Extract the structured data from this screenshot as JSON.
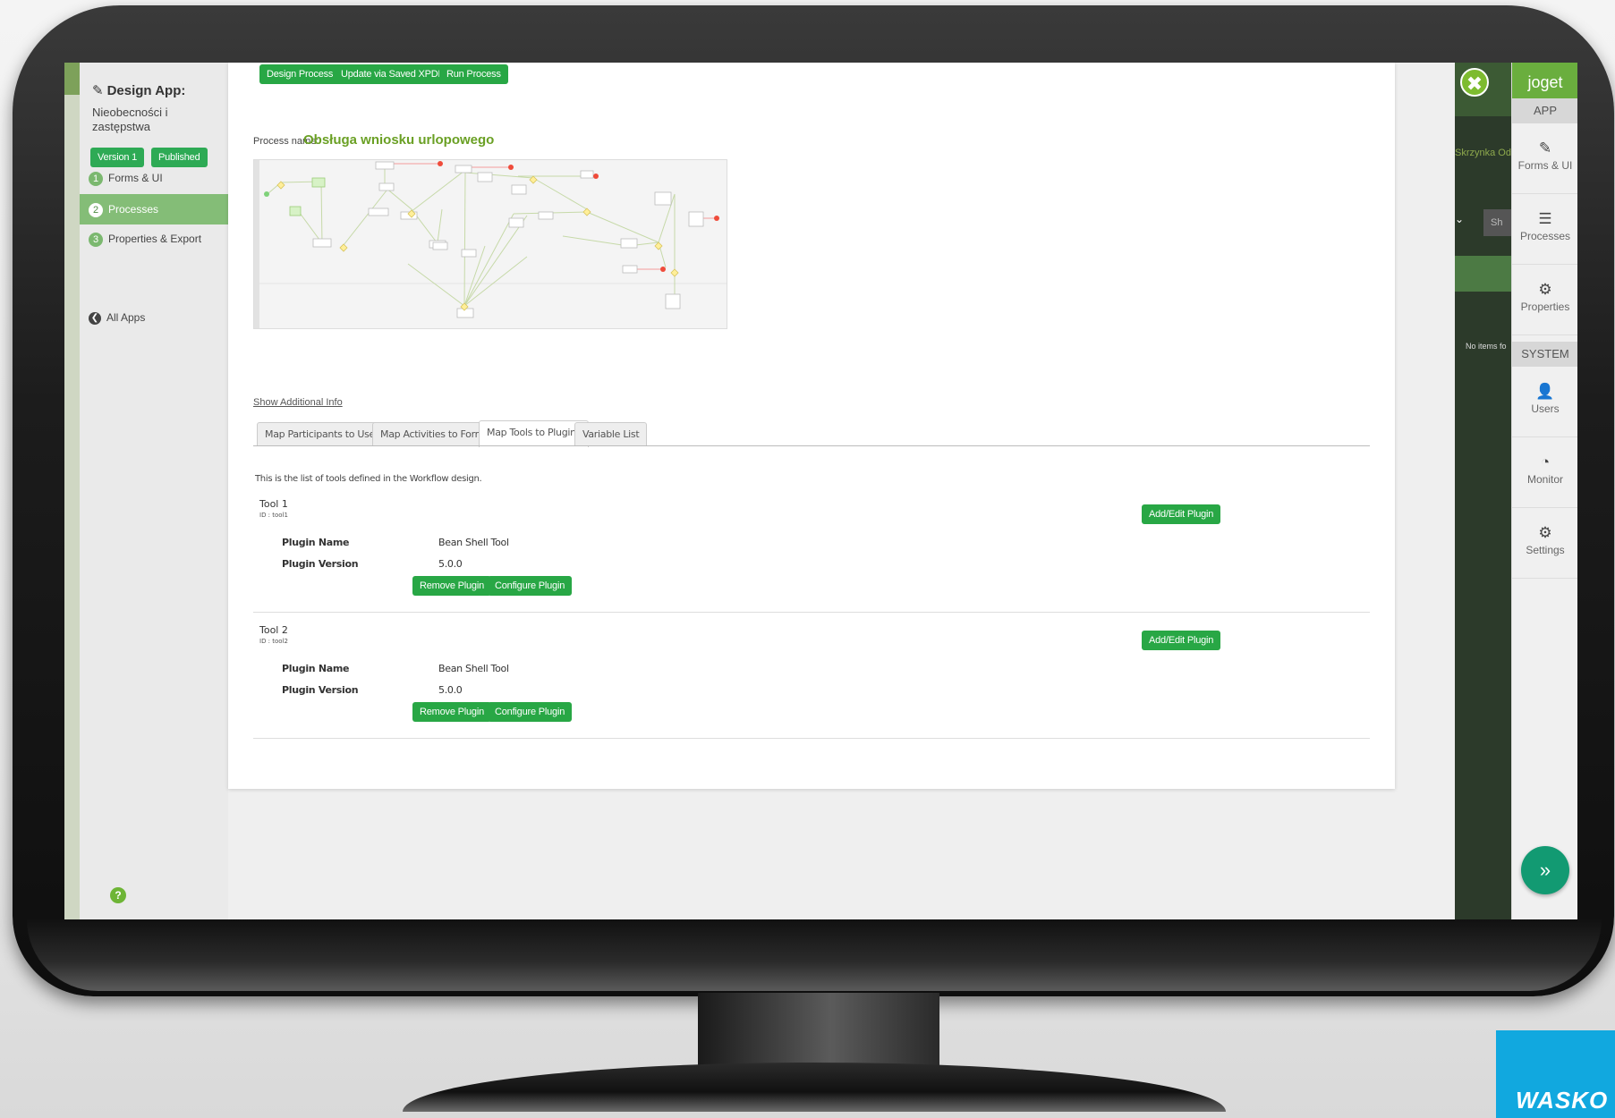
{
  "builder": {
    "title": "Design App:",
    "app_name": "Nieobecności i zastępstwa",
    "version_badge": "Version 1",
    "published_badge": "Published",
    "steps": [
      {
        "num": "1",
        "label": "Forms & UI"
      },
      {
        "num": "2",
        "label": "Processes"
      },
      {
        "num": "3",
        "label": "Properties & Export"
      }
    ],
    "all_apps": "All Apps"
  },
  "toolbar": {
    "design_process": "Design Process",
    "update_xpdl": "Update via Saved XPDL",
    "run_process": "Run Process"
  },
  "process": {
    "name_label": "Process name:",
    "name": "Obsługa wniosku urlopowego"
  },
  "show_additional_info": "Show Additional Info",
  "tabs": [
    "Map Participants to Users",
    "Map Activities to Forms",
    "Map Tools to Plugins",
    "Variable List"
  ],
  "tools_description": "This is the list of tools defined in the Workflow design.",
  "tools": [
    {
      "name": "Tool 1",
      "id": "ID : tool1",
      "plugin_name_label": "Plugin Name",
      "plugin_name": "Bean Shell Tool",
      "plugin_version_label": "Plugin Version",
      "plugin_version": "5.0.0",
      "add_edit": "Add/Edit Plugin",
      "remove": "Remove Plugin",
      "configure": "Configure Plugin"
    },
    {
      "name": "Tool 2",
      "id": "ID : tool2",
      "plugin_name_label": "Plugin Name",
      "plugin_name": "Bean Shell Tool",
      "plugin_version_label": "Plugin Version",
      "plugin_version": "5.0.0",
      "add_edit": "Add/Edit Plugin",
      "remove": "Remove Plugin",
      "configure": "Configure Plugin"
    }
  ],
  "background_app": {
    "crumb": "Skrzynka Od",
    "show_button": "Sh",
    "no_items": "No items fo"
  },
  "admin_bar": {
    "logo": "joget",
    "app_header": "APP",
    "system_header": "SYSTEM",
    "items": {
      "forms_ui": "Forms & UI",
      "processes": "Processes",
      "properties": "Properties",
      "users": "Users",
      "monitor": "Monitor",
      "settings": "Settings"
    }
  },
  "brand": "WASKO",
  "colors": {
    "primary_button": "#28a745",
    "process_name": "#6aa024",
    "active_step": "#84bd77",
    "joget_green": "#6aae3e"
  }
}
